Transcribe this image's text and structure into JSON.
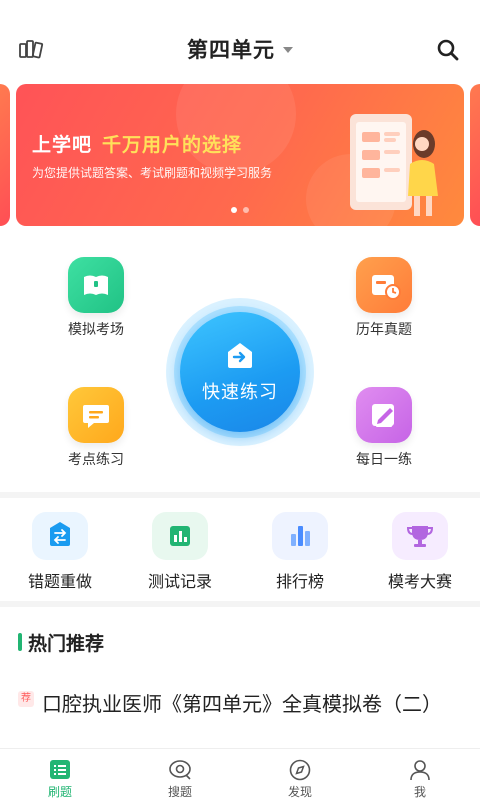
{
  "header": {
    "title": "第四单元",
    "left_icon": "book-stack-icon",
    "search_icon": "search-icon"
  },
  "banner": {
    "title_part1": "上学吧",
    "title_part2": "千万用户的选择",
    "subtitle": "为您提供试题答案、考试刷题和视频学习服务",
    "slide_count": 2,
    "active_slide": 1
  },
  "features": [
    {
      "label": "模拟考场",
      "icon": "book-icon",
      "color": "#21c285"
    },
    {
      "label": "历年真题",
      "icon": "calendar-clock-icon",
      "color": "#ff7c39"
    },
    {
      "label": "考点练习",
      "icon": "message-icon",
      "color": "#ffa81c"
    },
    {
      "label": "每日一练",
      "icon": "edit-icon",
      "color": "#c664e6"
    }
  ],
  "quick_practice": {
    "label": "快速练习",
    "icon": "arrow-box-icon",
    "color": "#1c9bf2"
  },
  "tools": [
    {
      "label": "错题重做",
      "icon": "swap-icon",
      "color": "#1a9bf0"
    },
    {
      "label": "测试记录",
      "icon": "bar-chart-icon",
      "color": "#22b573"
    },
    {
      "label": "排行榜",
      "icon": "ranking-icon",
      "color": "#4a8cff"
    },
    {
      "label": "模考大赛",
      "icon": "trophy-icon",
      "color": "#b266e0"
    }
  ],
  "hot": {
    "title": "热门推荐",
    "tag": "荐",
    "item_title": "口腔执业医师《第四单元》全真模拟卷（二）"
  },
  "tabbar": [
    {
      "label": "刷题",
      "icon": "list-icon",
      "active": true
    },
    {
      "label": "搜题",
      "icon": "search-eye-icon",
      "active": false
    },
    {
      "label": "发现",
      "icon": "compass-icon",
      "active": false
    },
    {
      "label": "我",
      "icon": "user-icon",
      "active": false
    }
  ],
  "colors": {
    "accent": "#22b573",
    "banner": "#ff5a50",
    "highlight": "#ffe15a"
  }
}
